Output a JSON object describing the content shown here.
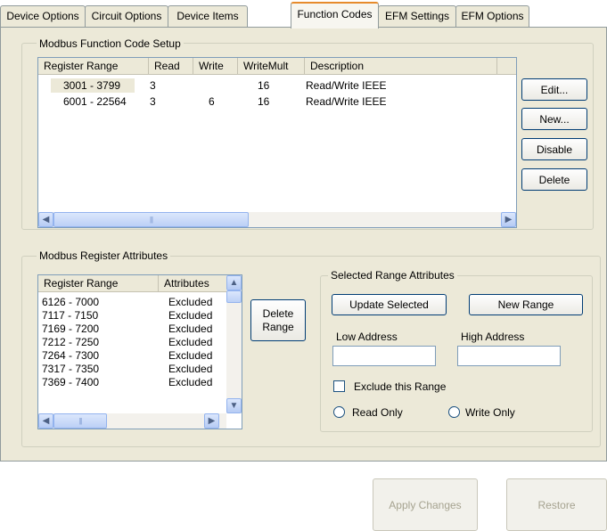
{
  "tabs": [
    "Device Options",
    "Circuit Options",
    "Device Items",
    "Function Codes",
    "EFM Settings",
    "EFM Options"
  ],
  "function_code_group": {
    "title": "Modbus Function Code Setup",
    "columns": [
      "Register Range",
      "Read",
      "Write",
      "WriteMult",
      "Description"
    ],
    "rows": [
      {
        "range": "3001 - 3799",
        "read": "3",
        "write": "",
        "writemult": "16",
        "description": "Read/Write IEEE"
      },
      {
        "range": "6001 - 22564",
        "read": "3",
        "write": "6",
        "writemult": "16",
        "description": "Read/Write IEEE"
      }
    ],
    "buttons": {
      "edit": "Edit...",
      "new": "New...",
      "disable": "Disable",
      "delete": "Delete"
    }
  },
  "register_attributes_group": {
    "title": "Modbus Register Attributes",
    "columns": [
      "Register Range",
      "Attributes"
    ],
    "rows": [
      {
        "range": "6126 - 7000",
        "attr": "Excluded"
      },
      {
        "range": "7117 - 7150",
        "attr": "Excluded"
      },
      {
        "range": "7169 - 7200",
        "attr": "Excluded"
      },
      {
        "range": "7212 - 7250",
        "attr": "Excluded"
      },
      {
        "range": "7264 - 7300",
        "attr": "Excluded"
      },
      {
        "range": "7317 - 7350",
        "attr": "Excluded"
      },
      {
        "range": "7369 - 7400",
        "attr": "Excluded"
      }
    ],
    "delete_range_line1": "Delete",
    "delete_range_line2": "Range"
  },
  "selected_range_group": {
    "title": "Selected Range Attributes",
    "update_selected": "Update Selected",
    "new_range": "New Range",
    "low_address_label": "Low Address",
    "high_address_label": "High Address",
    "low_address_value": "",
    "high_address_value": "",
    "exclude_label": "Exclude this Range",
    "read_only_label": "Read Only",
    "write_only_label": "Write Only"
  },
  "footer": {
    "apply": "Apply Changes",
    "restore": "Restore"
  }
}
